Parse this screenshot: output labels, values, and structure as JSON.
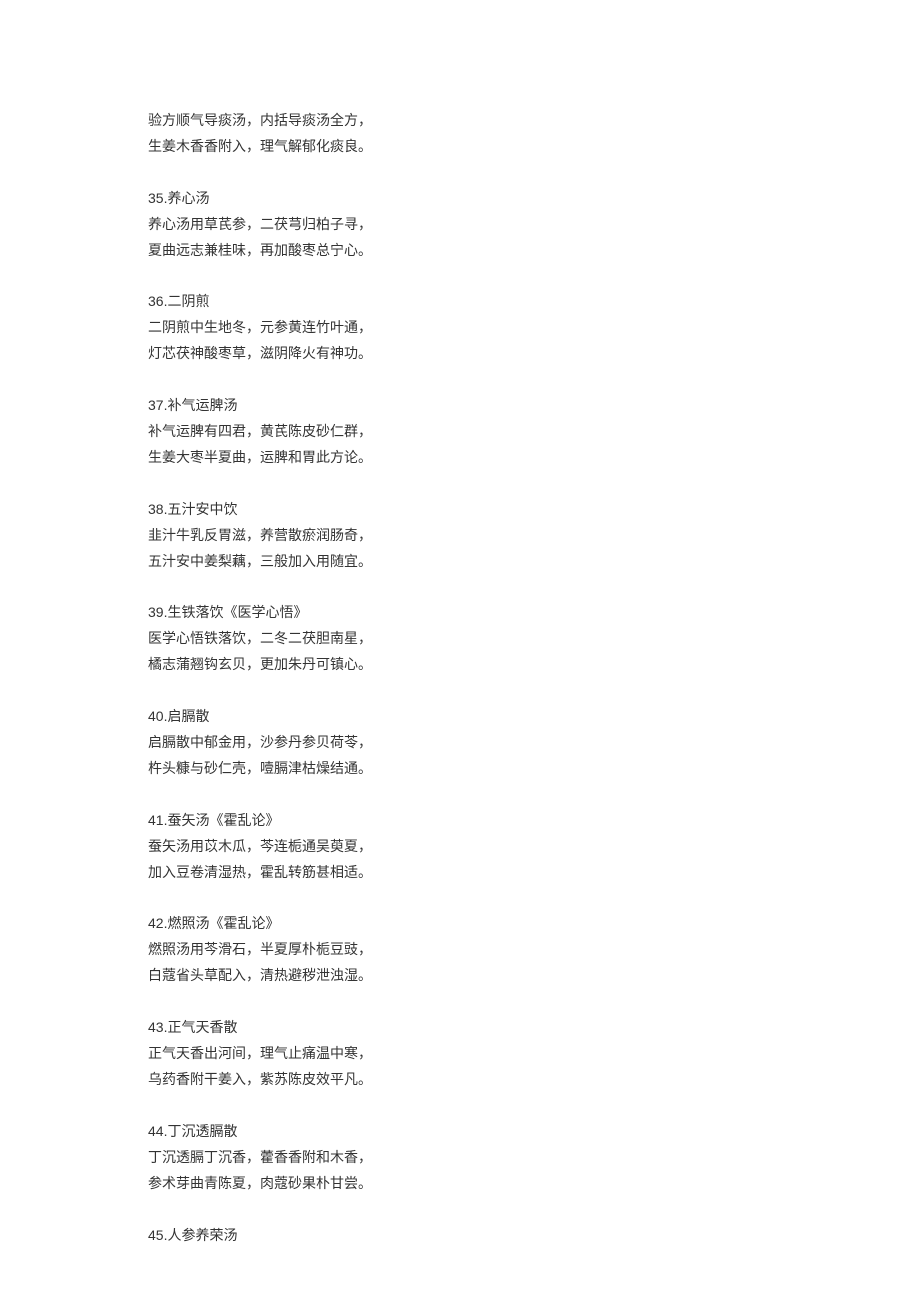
{
  "entries": [
    {
      "title": null,
      "lines": [
        "验方顺气导痰汤，内括导痰汤全方，",
        "生姜木香香附入，理气解郁化痰良。"
      ]
    },
    {
      "title": "35.养心汤",
      "lines": [
        "养心汤用草芪参，二茯芎归柏子寻，",
        "夏曲远志兼桂味，再加酸枣总宁心。"
      ]
    },
    {
      "title": "36.二阴煎",
      "lines": [
        "二阴煎中生地冬，元参黄连竹叶通，",
        "灯芯茯神酸枣草，滋阴降火有神功。"
      ]
    },
    {
      "title": "37.补气运脾汤",
      "lines": [
        "补气运脾有四君，黄芪陈皮砂仁群，",
        "生姜大枣半夏曲，运脾和胃此方论。"
      ]
    },
    {
      "title": "38.五汁安中饮",
      "lines": [
        "韭汁牛乳反胃滋，养营散瘀润肠奇，",
        "五汁安中姜梨藕，三般加入用随宜。"
      ]
    },
    {
      "title": "39.生铁落饮《医学心悟》",
      "lines": [
        "医学心悟铁落饮，二冬二茯胆南星，",
        "橘志蒲翘钩玄贝，更加朱丹可镇心。"
      ]
    },
    {
      "title": "40.启膈散",
      "lines": [
        "启膈散中郁金用，沙参丹参贝荷苓，",
        "杵头糠与砂仁壳，噎膈津枯燥结通。"
      ]
    },
    {
      "title": "41.蚕矢汤《霍乱论》",
      "lines": [
        "蚕矢汤用苡木瓜，芩连栀通吴萸夏，",
        "加入豆卷清湿热，霍乱转筋甚相适。"
      ]
    },
    {
      "title": "42.燃照汤《霍乱论》",
      "lines": [
        "燃照汤用芩滑石，半夏厚朴栀豆豉，",
        "白蔻省头草配入，清热避秽泄浊湿。"
      ]
    },
    {
      "title": "43.正气天香散",
      "lines": [
        "正气天香出河间，理气止痛温中寒，",
        "乌药香附干姜入，紫苏陈皮效平凡。"
      ]
    },
    {
      "title": "44.丁沉透膈散",
      "lines": [
        "丁沉透膈丁沉香，藿香香附和木香，",
        "参术芽曲青陈夏，肉蔻砂果朴甘尝。"
      ]
    },
    {
      "title": "45.人参养荣汤",
      "lines": []
    }
  ]
}
